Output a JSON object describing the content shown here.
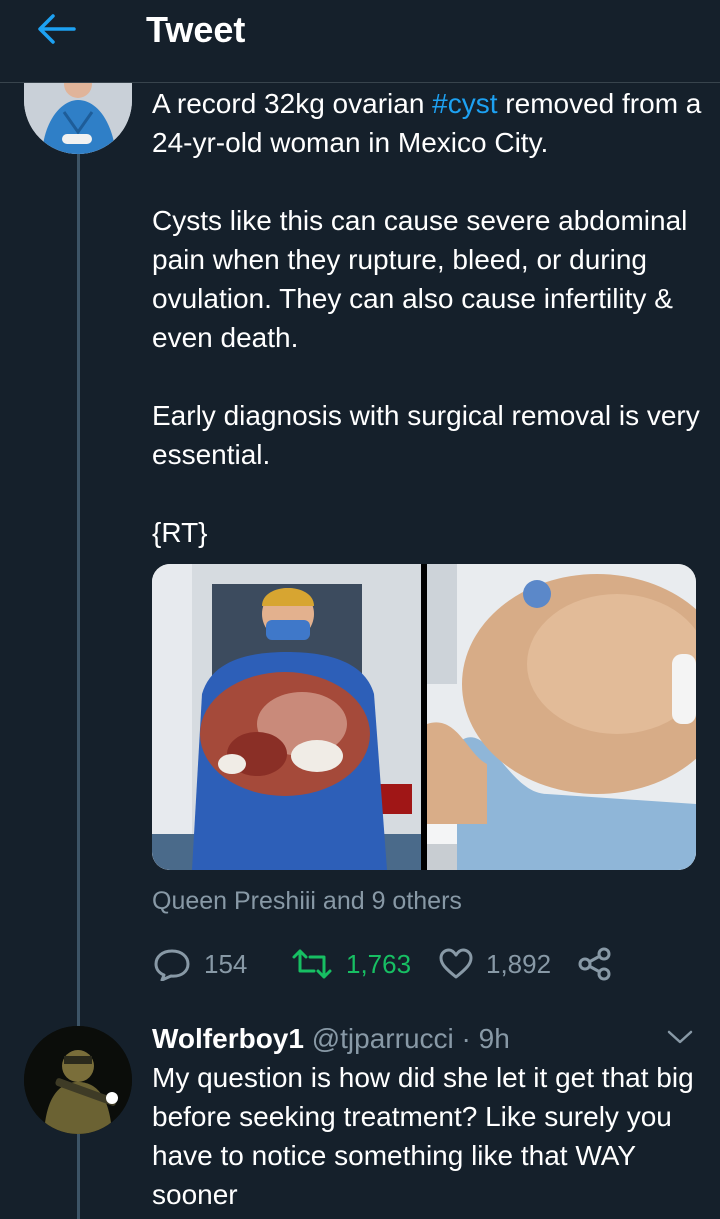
{
  "header": {
    "title": "Tweet",
    "back_icon": "arrow-left-icon",
    "accent": "#1da1f2"
  },
  "tweet": {
    "text_before_hashtag": "A record 32kg ovarian ",
    "hashtag": "#cyst",
    "text_after_hashtag": " removed from a 24-yr-old woman in Mexico City.\n\nCysts like this can cause severe abdominal pain when they rupture, bleed, or during ovulation. They can also cause infertility & even death.\n\nEarly diagnosis with surgical removal is very essential.\n\n{RT}",
    "media": [
      "surgeon holding large ovarian cyst",
      "patient abdomen with cyst"
    ],
    "liked_by": "Queen Preshiii and 9 others",
    "actions": {
      "replies": "154",
      "retweets": "1,763",
      "likes": "1,892"
    },
    "retweet_color": "#17bf63",
    "muted_color": "#8899a6"
  },
  "reply": {
    "name": "Wolferboy1",
    "handle_time": " @tjparrucci · 9h",
    "text": "My question is how did she let it get that big before seeking treatment? Like surely you have to notice something like that WAY sooner"
  }
}
